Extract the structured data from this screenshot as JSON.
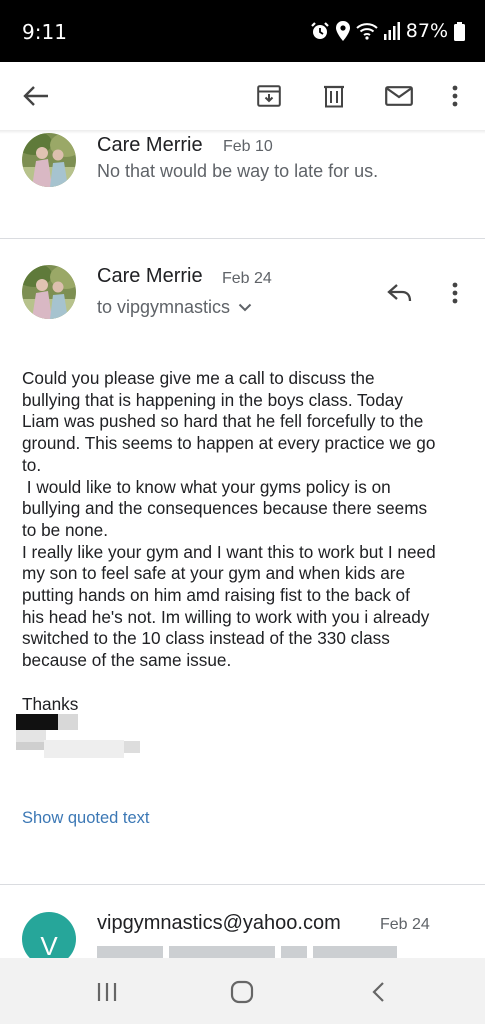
{
  "status_bar": {
    "time": "9:11",
    "battery": "87%",
    "icons": [
      "alarm-icon",
      "location-icon",
      "wifi-icon",
      "signal-icon",
      "battery-icon"
    ]
  },
  "toolbar": {
    "back": "back-arrow-icon",
    "archive": "archive-icon",
    "delete": "trash-icon",
    "mark_unread": "mail-icon",
    "more": "more-vert-icon"
  },
  "messages": [
    {
      "sender": "Care Merrie",
      "date": "Feb 10",
      "snippet": "No that would be way to late for us."
    },
    {
      "sender": "Care Merrie",
      "date": "Feb 24",
      "recipient": "to vipgymnastics",
      "body": [
        "Could you please give me a call to discuss the",
        "bullying that is happening in the boys class. Today",
        "Liam was pushed so hard that he fell forcefully to the",
        "ground. This seems to happen at every practice we go",
        "to.",
        " I would like to know what your gyms policy is on",
        "bullying and the consequences because there seems",
        "to be none.",
        "I really like your gym and I want this to work but I need",
        "my son to feel safe at your gym and when kids are",
        "putting hands on him amd raising fist to the back of",
        "his head he's not. Im willing to work with you i already",
        "switched to the 10 class instead of the 330 class",
        "because of the same issue.",
        "",
        "Thanks"
      ],
      "show_quoted": "Show quoted text"
    },
    {
      "sender": "vipgymnastics@yahoo.com",
      "date": "Feb 24",
      "avatar_letter": "V"
    }
  ],
  "colors": {
    "link": "#3c78b5",
    "avatar_v": "#26a69a",
    "secondary_text": "#5f6368"
  }
}
